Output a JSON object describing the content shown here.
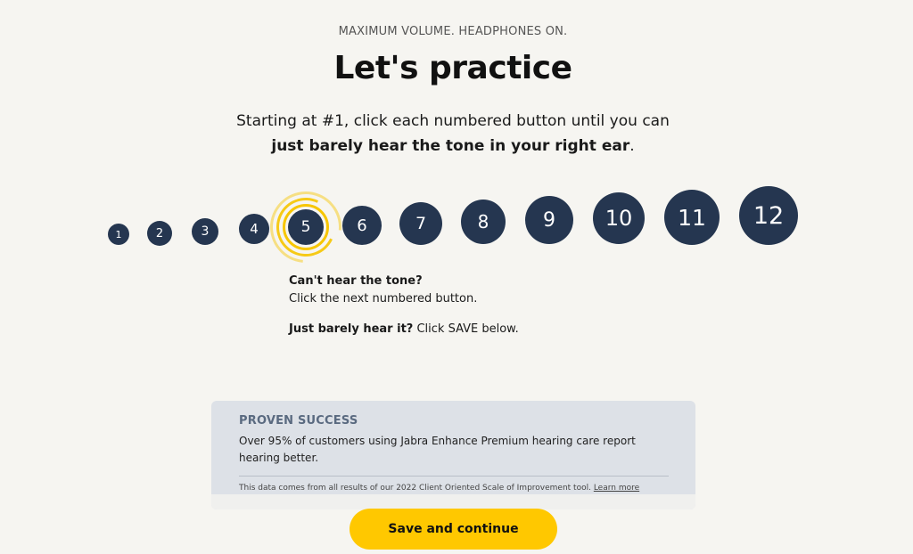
{
  "header": {
    "eyebrow": "MAXIMUM VOLUME. HEADPHONES ON.",
    "title": "Let's practice",
    "instruction_line1": "Starting at #1, click each numbered button until you can",
    "instruction_bold": "just barely hear the tone in your right ear",
    "instruction_end": "."
  },
  "tone_buttons": {
    "labels": [
      "1",
      "2",
      "3",
      "4",
      "5",
      "6",
      "7",
      "8",
      "9",
      "10",
      "11",
      "12"
    ],
    "active_index": 4,
    "button_color": "#253650",
    "active_ring_color": "#f7c600"
  },
  "help": {
    "q1_bold": "Can't hear the tone?",
    "q1_text": "Click the next numbered button.",
    "q2_bold": "Just barely hear it?",
    "q2_text": " Click SAVE below."
  },
  "card": {
    "label": "PROVEN SUCCESS",
    "text": "Over 95% of customers using Jabra Enhance Premium hearing care report hearing better.",
    "note": "This data comes from all results of our 2022 Client Oriented Scale of Improvement tool. ",
    "link": "Learn more"
  },
  "footer": {
    "save_label": "Save and continue",
    "save_color": "#ffc800"
  }
}
